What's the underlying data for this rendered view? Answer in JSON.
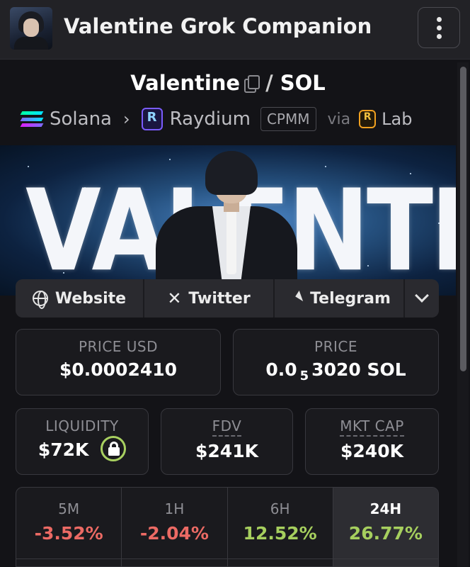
{
  "header": {
    "app_title": "Valentine Grok Companion",
    "menu_icon": "more-vertical-icon"
  },
  "pair": {
    "base": "Valentine",
    "separator": "/",
    "quote": "SOL"
  },
  "chain": {
    "network": "Solana",
    "dex": "Raydium",
    "pool_type": "CPMM",
    "via": "via",
    "launchpad": "Lab"
  },
  "banner": {
    "text": "VALENTINE"
  },
  "social": {
    "website": "Website",
    "twitter": "Twitter",
    "telegram": "Telegram"
  },
  "stats": {
    "price_usd_label": "PRICE USD",
    "price_usd_value": "$0.0002410",
    "price_label": "PRICE",
    "price_prefix": "0.0",
    "price_sub": "5",
    "price_suffix": "3020 SOL",
    "liquidity_label": "LIQUIDITY",
    "liquidity_value": "$72K",
    "fdv_label": "FDV",
    "fdv_value": "$241K",
    "mktcap_label": "MKT CAP",
    "mktcap_value": "$240K"
  },
  "timeframes": [
    {
      "label": "5M",
      "value": "-3.52%",
      "trend": "neg"
    },
    {
      "label": "1H",
      "value": "-2.04%",
      "trend": "neg"
    },
    {
      "label": "6H",
      "value": "12.52%",
      "trend": "pos"
    },
    {
      "label": "24H",
      "value": "26.77%",
      "trend": "pos"
    }
  ],
  "colors": {
    "negative": "#ec6a64",
    "positive": "#a6cf5e",
    "background": "#131317"
  }
}
